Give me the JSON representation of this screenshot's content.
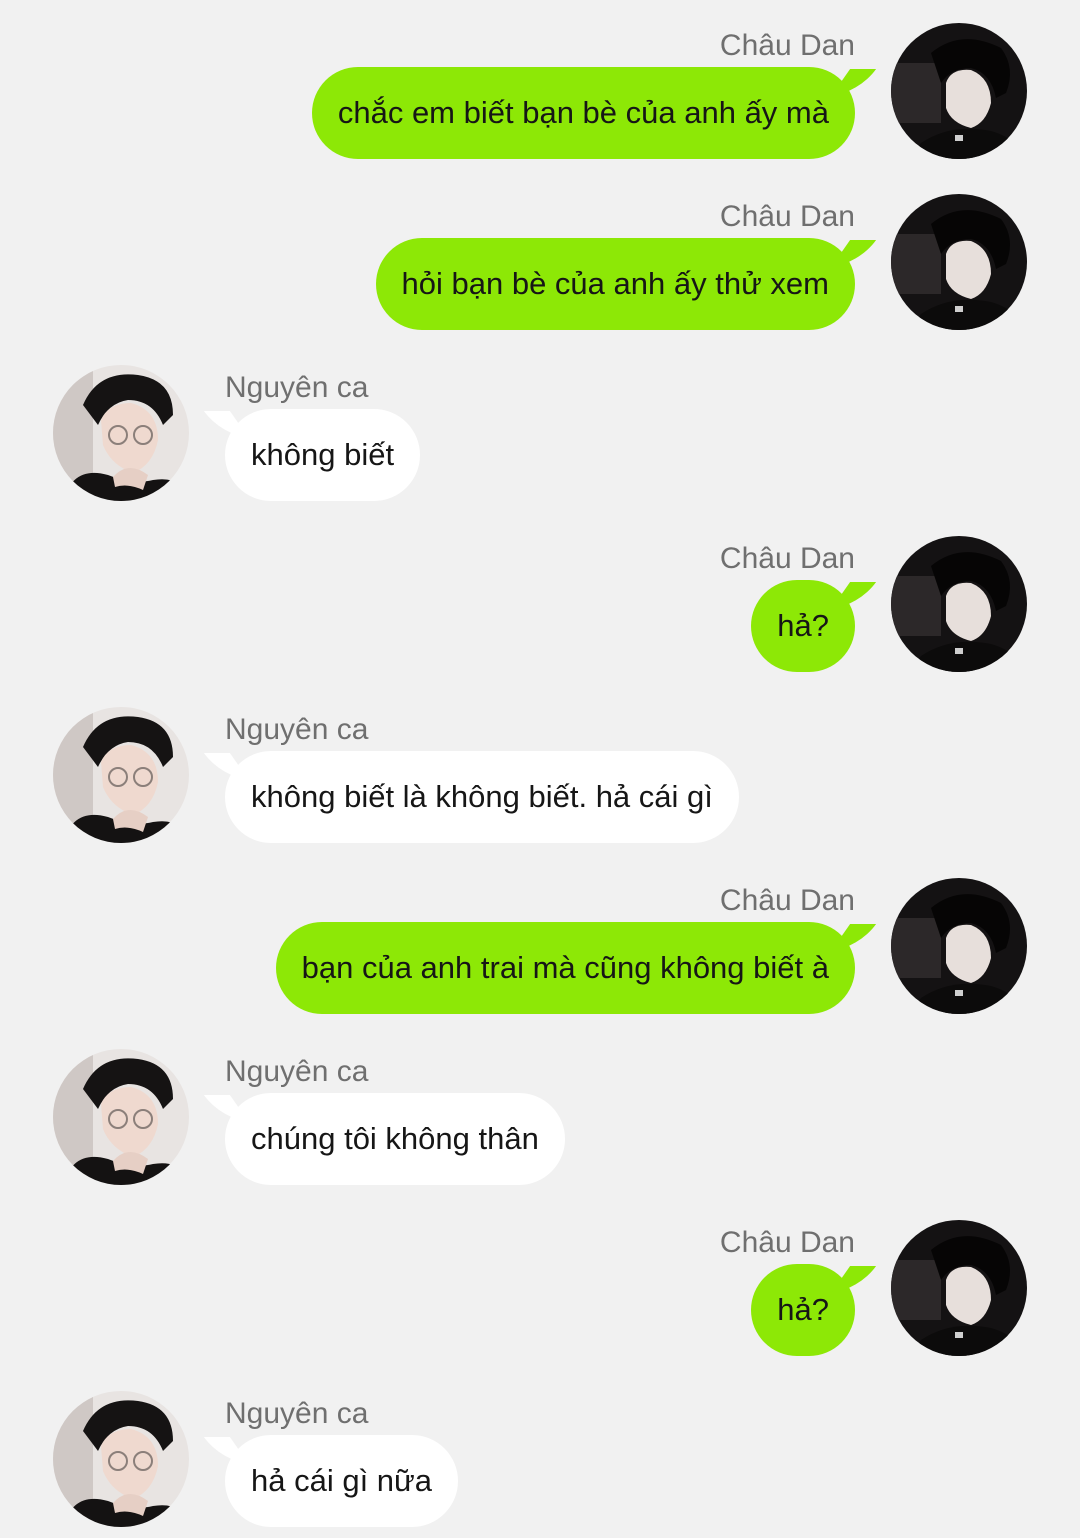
{
  "colors": {
    "background": "#f1f1f1",
    "outgoing_bubble": "#8de806",
    "incoming_bubble": "#ffffff",
    "sender_name": "#6f6f6f",
    "message_text": "#161616"
  },
  "messages": [
    {
      "direction": "out",
      "sender": "Châu Dan",
      "text": "chắc em biết bạn bè của anh ấy mà",
      "avatar_icon": "profile-photo-dark"
    },
    {
      "direction": "out",
      "sender": "Châu Dan",
      "text": "hỏi bạn bè của anh ấy thử xem",
      "avatar_icon": "profile-photo-dark"
    },
    {
      "direction": "in",
      "sender": "Nguyên ca",
      "text": "không biết",
      "avatar_icon": "profile-photo-glasses"
    },
    {
      "direction": "out",
      "sender": "Châu Dan",
      "text": "hả?",
      "avatar_icon": "profile-photo-dark"
    },
    {
      "direction": "in",
      "sender": "Nguyên ca",
      "text": "không biết là không biết. hả cái gì",
      "avatar_icon": "profile-photo-glasses"
    },
    {
      "direction": "out",
      "sender": "Châu Dan",
      "text": "bạn của anh trai mà cũng không biết à",
      "avatar_icon": "profile-photo-dark"
    },
    {
      "direction": "in",
      "sender": "Nguyên ca",
      "text": "chúng tôi không thân",
      "avatar_icon": "profile-photo-glasses"
    },
    {
      "direction": "out",
      "sender": "Châu Dan",
      "text": "hả?",
      "avatar_icon": "profile-photo-dark"
    },
    {
      "direction": "in",
      "sender": "Nguyên ca",
      "text": "hả cái gì nữa",
      "avatar_icon": "profile-photo-glasses"
    }
  ]
}
